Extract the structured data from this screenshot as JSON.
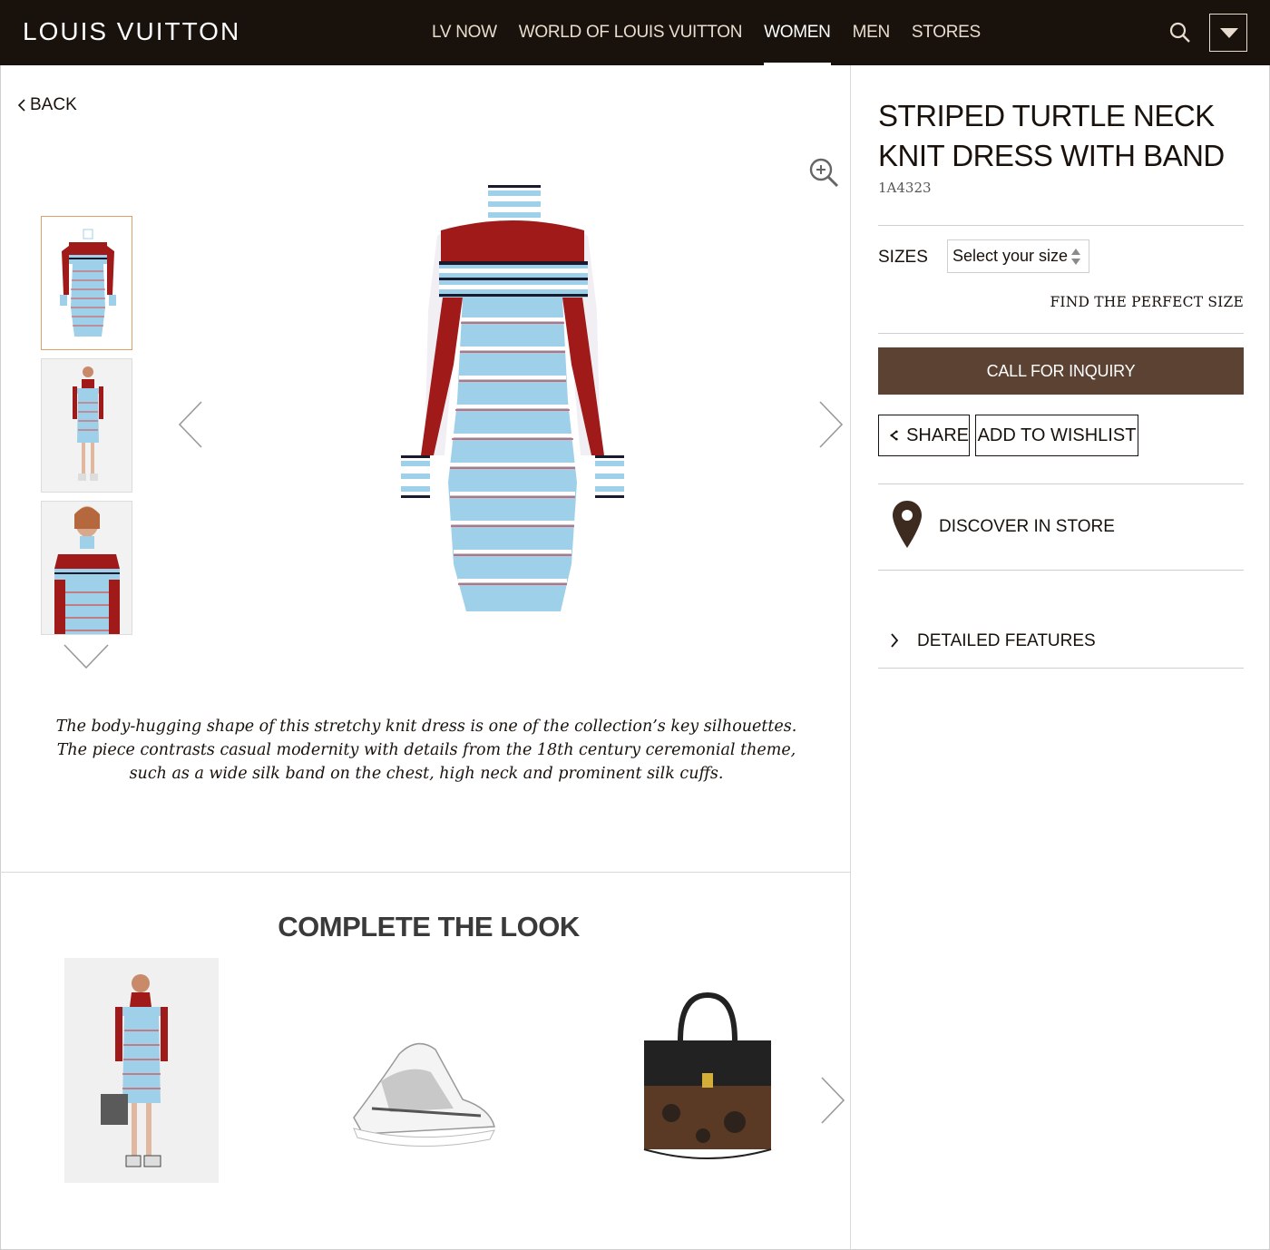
{
  "header": {
    "logo": "LOUIS VUITTON",
    "nav": [
      "LV NOW",
      "WORLD OF LOUIS VUITTON",
      "WOMEN",
      "MEN",
      "STORES"
    ],
    "active_nav": "WOMEN"
  },
  "gallery": {
    "back_label": "BACK",
    "thumbnails": [
      "front-view",
      "model-full",
      "model-closeup"
    ],
    "selected_thumbnail": 0
  },
  "product": {
    "description": "The body-hugging shape of this stretchy knit dress is one of the collection’s key silhouettes. The piece contrasts casual modernity with details from the 18th century ceremonial theme, such as a wide silk band on the chest, high neck and prominent silk cuffs.",
    "title": "STRIPED TURTLE NECK KNIT DRESS WITH BAND",
    "sku": "1A4323",
    "sizes_label": "SIZES",
    "size_placeholder": "Select your size",
    "find_size": "FIND THE PERFECT SIZE",
    "inquiry_label": "CALL FOR INQUIRY",
    "share_label": "SHARE",
    "wishlist_label": "ADD TO WISHLIST",
    "discover_label": "DISCOVER IN STORE",
    "features_label": "DETAILED FEATURES"
  },
  "complete_look": {
    "title": "COMPLETE THE LOOK",
    "items": [
      "model-look",
      "sneaker",
      "handbag"
    ]
  },
  "colors": {
    "header_bg": "#19110b",
    "nav_text": "#e8dccf",
    "inquiry_bg": "#5b4233",
    "dress_red": "#a01a1a",
    "dress_blue": "#9fd0ea"
  }
}
